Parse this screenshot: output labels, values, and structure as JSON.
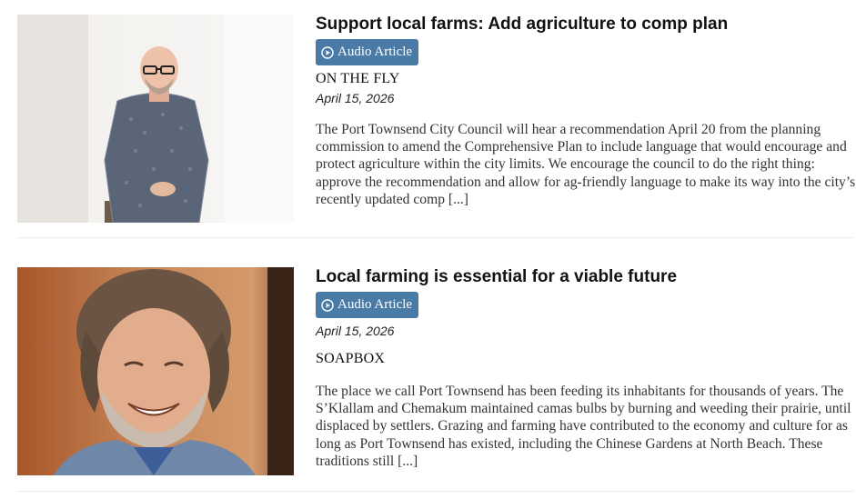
{
  "articles": [
    {
      "title": "Support local farms: Add agriculture to comp plan",
      "audio_label": "Audio Article",
      "section": "ON THE FLY",
      "date": "April 15, 2026",
      "excerpt": "The Port Townsend City Council will hear a recommendation April 20 from the planning commission to amend the Comprehensive Plan to include language that would encourage and protect agriculture within the city limits. We encourage the council to do the right thing: approve the recommendation and allow for ag-friendly language to make its way into the city’s recently updated comp [...]"
    },
    {
      "title": "Local farming is essential for a viable future",
      "audio_label": "Audio Article",
      "section": "SOAPBOX",
      "date": "April 15, 2026",
      "excerpt": "The place we call Port Townsend has been feeding its inhabitants for thousands of years. The S’Klallam and Chemakum maintained camas bulbs by burning and weeding their prairie, until displaced by settlers. Grazing and farming have contributed to the economy and culture for as long as Port Townsend has existed, including the Chinese Gardens at North Beach. These traditions still [...]"
    }
  ],
  "icons": {
    "audio": "play-circle-icon"
  },
  "colors": {
    "audio_button": "#4a7aa6",
    "title": "#111111",
    "excerpt": "#333333"
  }
}
